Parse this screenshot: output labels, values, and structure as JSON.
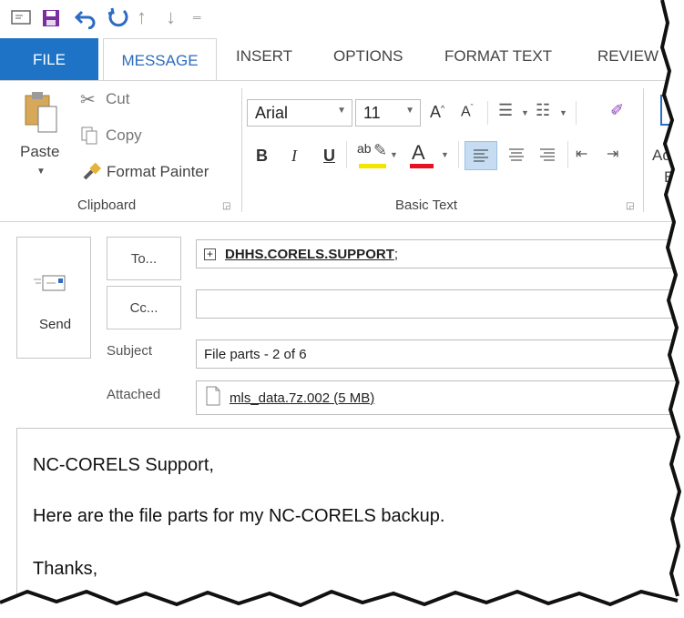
{
  "quick_access": {
    "icons": [
      "email-icon",
      "save-icon",
      "undo-icon",
      "redo-icon",
      "up-icon",
      "down-icon",
      "customize-icon"
    ]
  },
  "tabs": {
    "file": "FILE",
    "message": "MESSAGE",
    "insert": "INSERT",
    "options": "OPTIONS",
    "format_text": "FORMAT TEXT",
    "review": "REVIEW"
  },
  "clipboard": {
    "paste": "Paste",
    "cut": "Cut",
    "copy": "Copy",
    "format_painter": "Format Painter",
    "group_label": "Clipboard"
  },
  "basic_text": {
    "font": "Arial",
    "size": "11",
    "bold": "B",
    "italic": "I",
    "underline": "U",
    "font_color_letter": "A",
    "highlight_letter": "ab",
    "group_label": "Basic Text",
    "highlight_color": "#f2e600",
    "font_color": "#e81123"
  },
  "address_partial": {
    "line1": "Ad",
    "line2": "B"
  },
  "compose": {
    "send_label": "Send",
    "to_label": "To...",
    "cc_label": "Cc...",
    "subject_label": "Subject",
    "attached_label": "Attached",
    "to_value": "DHHS.CORELS.SUPPORT",
    "to_separator": ";",
    "cc_value": "",
    "subject_value": "File parts - 2 of 6",
    "attachment": "mls_data.7z.002 (5 MB)"
  },
  "body": {
    "line1": "NC-CORELS Support,",
    "line2": "Here are the file parts for my NC-CORELS backup.",
    "line3": "Thanks,"
  },
  "colors": {
    "file_tab": "#1e73c6",
    "accent_text": "#2c6cbd",
    "purple_icon": "#8a3ab0"
  }
}
